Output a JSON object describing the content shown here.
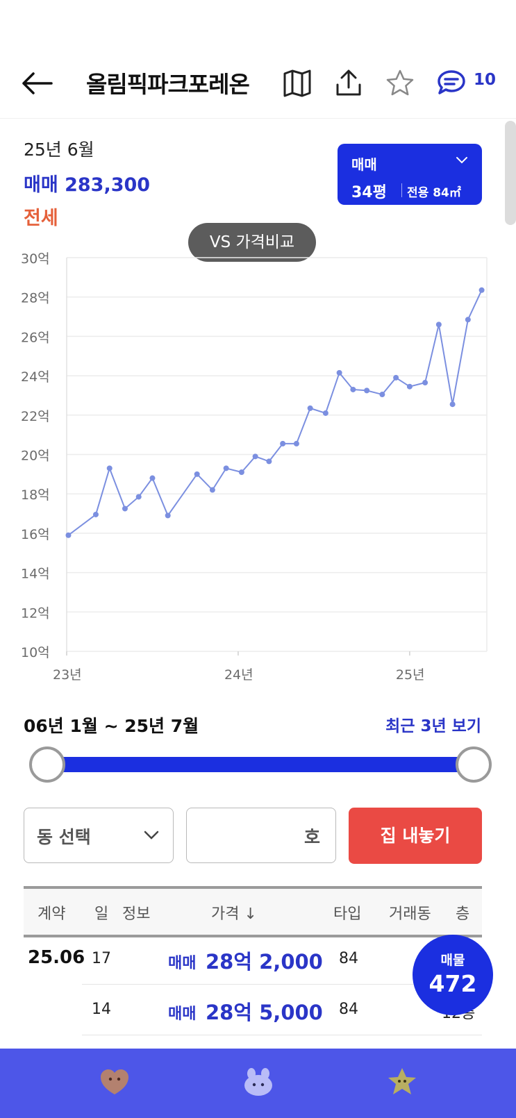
{
  "header": {
    "title": "올림픽파크포레온",
    "comment_count": "10"
  },
  "summary": {
    "date": "25년 6월",
    "sale_label": "매매 283,300",
    "jeonse_label": "전세"
  },
  "type_selector": {
    "trade_type": "매매",
    "pyeong": "34평",
    "area": "전용 84㎡"
  },
  "compare_button": "VS 가격비교",
  "colors": {
    "accent": "#1b2fe0",
    "link_blue": "#2a35c7",
    "jeonse": "#e5603a",
    "list_button": "#ea4a44",
    "line": "#7b8fe0",
    "nav_bg": "#4d56e8"
  },
  "chart_data": {
    "type": "line",
    "y_ticks": [
      "30억",
      "28억",
      "26억",
      "24억",
      "22억",
      "20억",
      "18억",
      "16억",
      "14억",
      "12억",
      "10억"
    ],
    "ylim": [
      10,
      30
    ],
    "x_ticks": [
      {
        "label": "23년",
        "x": 2023.0
      },
      {
        "label": "24년",
        "x": 2024.0
      },
      {
        "label": "25년",
        "x": 2025.0
      }
    ],
    "xlim": [
      2023.0,
      2025.45
    ],
    "grid": true,
    "series": [
      {
        "points": [
          [
            2023.01,
            15.9
          ],
          [
            2023.17,
            16.95
          ],
          [
            2023.25,
            19.3
          ],
          [
            2023.34,
            17.25
          ],
          [
            2023.42,
            17.85
          ],
          [
            2023.5,
            18.8
          ],
          [
            2023.59,
            16.9
          ],
          [
            2023.76,
            19.0
          ],
          [
            2023.85,
            18.2
          ],
          [
            2023.93,
            19.3
          ],
          [
            2024.02,
            19.1
          ],
          [
            2024.1,
            19.9
          ],
          [
            2024.18,
            19.65
          ],
          [
            2024.26,
            20.55
          ],
          [
            2024.34,
            20.55
          ],
          [
            2024.42,
            22.35
          ],
          [
            2024.51,
            22.1
          ],
          [
            2024.59,
            24.15
          ],
          [
            2024.67,
            23.3
          ],
          [
            2024.75,
            23.25
          ],
          [
            2024.84,
            23.05
          ],
          [
            2024.92,
            23.9
          ],
          [
            2025.0,
            23.45
          ],
          [
            2025.09,
            23.65
          ],
          [
            2025.17,
            26.6
          ],
          [
            2025.25,
            22.55
          ],
          [
            2025.34,
            26.85
          ],
          [
            2025.42,
            28.35
          ]
        ]
      }
    ]
  },
  "range": {
    "label": "06년 1월 ~ 25년 7월",
    "recent_link": "최근 3년 보기",
    "start_fraction": 0,
    "end_fraction": 1
  },
  "controls": {
    "dong_select": "동 선택",
    "ho_suffix": "호",
    "list_button": "집 내놓기"
  },
  "table": {
    "headers": [
      "계약",
      "일",
      "정보",
      "가격 ↓",
      "타입",
      "거래동",
      "층"
    ],
    "group_date": "25.06",
    "rows": [
      {
        "day": "17",
        "kind": "매매",
        "price": "28억 2,000",
        "type": "84",
        "floor": ""
      },
      {
        "day": "14",
        "kind": "매매",
        "price": "28억 5,000",
        "type": "84",
        "floor": "12층"
      }
    ]
  },
  "listing_badge": {
    "label": "매물",
    "count": "472"
  },
  "bottom_nav": {
    "icons": [
      "heart-face-icon",
      "bunny-face-icon",
      "star-face-icon"
    ]
  }
}
